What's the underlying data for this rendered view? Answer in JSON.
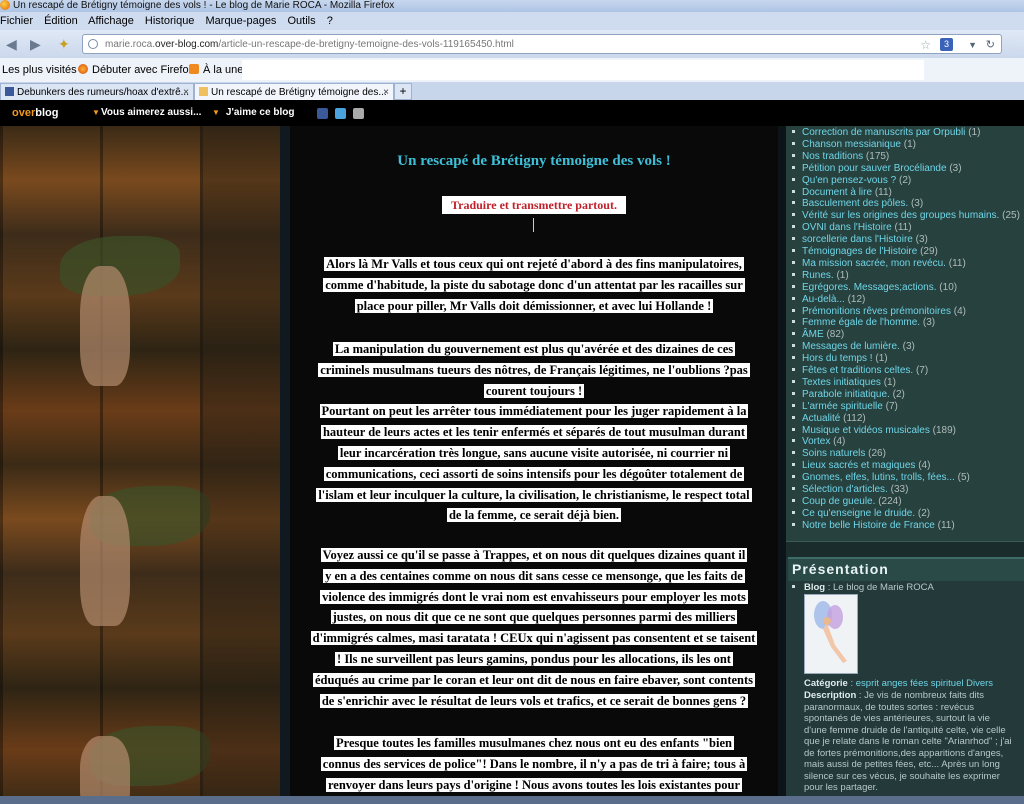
{
  "window": {
    "title": "Un rescapé de Brétigny témoigne des vols ! - Le blog de Marie ROCA - Mozilla Firefox"
  },
  "menu": [
    "Fichier",
    "Édition",
    "Affichage",
    "Historique",
    "Marque-pages",
    "Outils",
    "?"
  ],
  "urlbar": {
    "prefix": "marie.roca.",
    "domain": "over-blog.com",
    "path": "/article-un-rescape-de-bretigny-temoigne-des-vols-119165450.html",
    "badge": "3"
  },
  "bookmarks": [
    "Les plus visités",
    "Débuter avec Firefox",
    "À la une"
  ],
  "tabs": [
    {
      "label": "Debunkers des rumeurs/hoax d'extrê...",
      "active": false
    },
    {
      "label": "Un rescapé de Brétigny témoigne des...",
      "active": true
    }
  ],
  "overblog": {
    "logo_a": "over",
    "logo_b": "blog",
    "menu1": "Vous aimerez aussi...",
    "menu2": "J'aime ce blog"
  },
  "post": {
    "title": "Un rescapé de Brétigny témoigne des vols !",
    "subtitle": "Traduire et transmettre partout.",
    "paragraphs": [
      [
        "Alors là Mr Valls et tous ceux qui ont rejeté d'abord à des fins manipulatoires,",
        "comme d'habitude, la piste du sabotage donc d'un attentat par les racailles sur",
        "place pour piller, Mr Valls doit démissionner, et avec lui Hollande !"
      ],
      [
        "La manipulation du gouvernement est plus qu'avérée et des dizaines de ces",
        "criminels musulmans tueurs des nôtres, de Français légitimes, ne l'oublions ?pas",
        "courent toujours !",
        "Pourtant on peut les arrêter tous immédiatement pour les juger rapidement à la",
        "hauteur de leurs actes et les tenir enfermés et séparés de tout musulman durant",
        "leur incarcération très longue, sans aucune visite autorisée, ni courrier ni",
        "communications, ceci assorti de  soins intensifs pour les dégoûter totalement de",
        "l'islam et leur inculquer la culture, la civilisation, le christianisme, le respect total",
        "de la femme, ce serait déjà bien."
      ],
      [
        "Voyez aussi ce qu'il se passe à Trappes, et on nous dit quelques dizaines quant il",
        "y en a des centaines comme on nous dit sans cesse ce mensonge, que les faits de",
        "violence des immigrés dont le vrai nom est envahisseurs pour employer les mots",
        "justes, on nous dit que ce ne sont que quelques personnes parmi des milliers",
        "d'immigrés calmes, masi taratata ! CEUx qui n'agissent pas consentent et se taisent",
        "! Ils ne surveillent pas leurs gamins, pondus pour les allocations, ils les ont",
        "éduqués au crime par le coran et leur ont dit de nous en  faire ebaver, sont contents",
        "de s'enrichir avec le résultat de leurs vols et trafics, et ce serait de bonnes gens ?"
      ],
      [
        "Presque toutes les familles musulmanes chez nous ont eu des enfants \"bien",
        "connus des services de police\"! Dans le nombre, il n'y a pas de tri à faire; tous à",
        "renvoyer dans leurs pays d'origine ! Nous avons toutes les lois existantes pour"
      ]
    ]
  },
  "sidebar": {
    "categories": [
      {
        "name": "Correction de manuscrits par Orpubli",
        "count": "(1)"
      },
      {
        "name": "Chanson messianique",
        "count": "(1)"
      },
      {
        "name": "Nos traditions",
        "count": "(175)"
      },
      {
        "name": "Pétition pour sauver Brocéliande",
        "count": "(3)"
      },
      {
        "name": "Qu'en pensez-vous ?",
        "count": "(2)"
      },
      {
        "name": "Document à lire",
        "count": "(11)"
      },
      {
        "name": "Basculement des pôles.",
        "count": "(3)"
      },
      {
        "name": "Vérité sur les origines des groupes humains.",
        "count": "(25)"
      },
      {
        "name": "OVNI dans l'Histoire",
        "count": "(11)"
      },
      {
        "name": "sorcellerie dans l'Histoire",
        "count": "(3)"
      },
      {
        "name": "Témoignages de l'Histoire",
        "count": "(29)"
      },
      {
        "name": "Ma mission sacrée, mon revécu.",
        "count": "(11)"
      },
      {
        "name": "Runes.",
        "count": "(1)"
      },
      {
        "name": "Egrégores. Messages;actions.",
        "count": "(10)"
      },
      {
        "name": "Au-delà...",
        "count": "(12)"
      },
      {
        "name": "Prémonitions rêves prémonitoires",
        "count": "(4)"
      },
      {
        "name": "Femme égale de l'homme.",
        "count": "(3)"
      },
      {
        "name": "ÂME",
        "count": "(82)"
      },
      {
        "name": "Messages de lumière.",
        "count": "(3)"
      },
      {
        "name": "Hors du temps !",
        "count": "(1)"
      },
      {
        "name": "Fêtes et traditions celtes.",
        "count": "(7)"
      },
      {
        "name": "Textes initiatiques",
        "count": "(1)"
      },
      {
        "name": "Parabole initiatique.",
        "count": "(2)"
      },
      {
        "name": "L'armée spirituelle",
        "count": "(7)"
      },
      {
        "name": "Actualité",
        "count": "(112)"
      },
      {
        "name": "Musique et vidéos musicales",
        "count": "(189)"
      },
      {
        "name": "Vortex",
        "count": "(4)"
      },
      {
        "name": "Soins naturels",
        "count": "(26)"
      },
      {
        "name": "Lieux sacrés et magiques",
        "count": "(4)"
      },
      {
        "name": "Gnomes, elfes, lutins, trolls, fées...",
        "count": "(5)"
      },
      {
        "name": "Sélection d'articles.",
        "count": "(33)"
      },
      {
        "name": "Coup de gueule.",
        "count": "(224)"
      },
      {
        "name": "Ce qu'enseigne le druide.",
        "count": "(2)"
      },
      {
        "name": "Notre belle Histoire de France",
        "count": "(11)"
      }
    ],
    "presentation": {
      "heading": "Présentation",
      "blog_label": "Blog",
      "blog_value": " : Le blog de Marie ROCA",
      "category_label": "Catégorie",
      "category_value": "esprit anges fées spirituel Divers",
      "description_label": "Description",
      "description_lines": [
        " : Je vis de nombreux faits dits",
        "paranormaux, de toutes sortes : revécus",
        "spontanés de vies antérieures, surtout la vie",
        "d'une femme druide de l'antiquité celte, vie celle",
        "que je relate dans le roman celte \"Arianrhod\" ; j'ai",
        "de fortes prémonitions,des apparitions d'anges,",
        "mais aussi de petites fées, etc... Après un long",
        "silence sur ces vécus, je souhaite les exprimer",
        "pour les partager."
      ]
    }
  }
}
